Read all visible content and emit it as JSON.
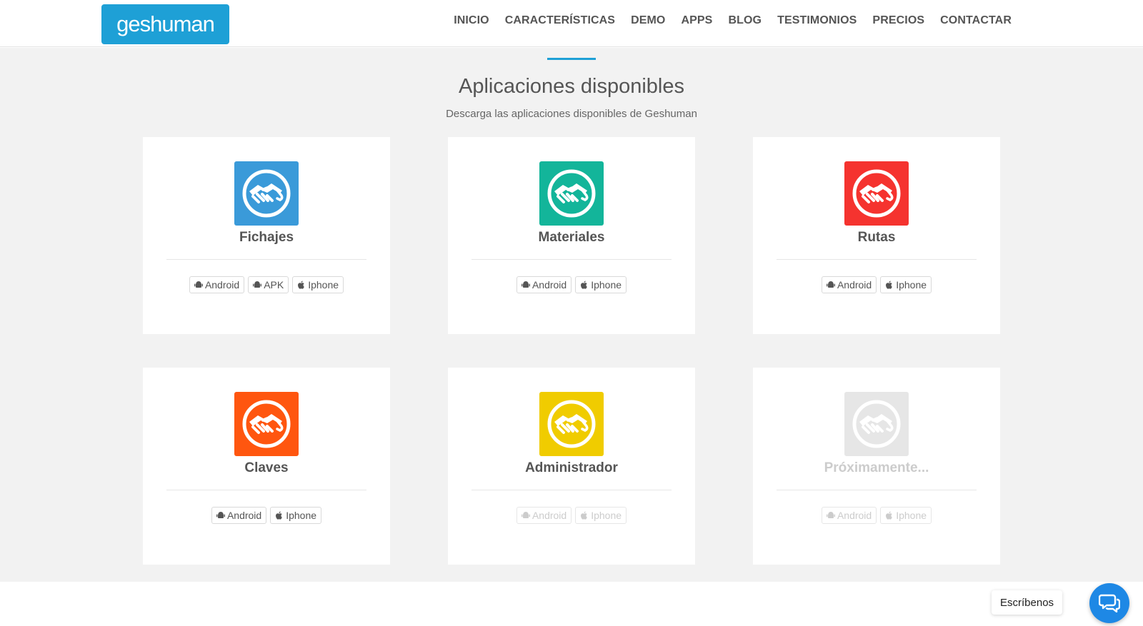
{
  "header": {
    "logo_text": "geshuman",
    "nav": [
      "INICIO",
      "CARACTERÍSTICAS",
      "DEMO",
      "APPS",
      "BLOG",
      "TESTIMONIOS",
      "PRECIOS",
      "CONTACTAR"
    ]
  },
  "section": {
    "title": "Aplicaciones disponibles",
    "subtitle": "Descarga las aplicaciones disponibles de Geshuman"
  },
  "apps": [
    {
      "name": "Fichajes",
      "color": "#3a9ad9",
      "buttons": [
        "Android",
        "APK",
        "Iphone"
      ],
      "disabled": false
    },
    {
      "name": "Materiales",
      "color": "#13b59a",
      "buttons": [
        "Android",
        "Iphone"
      ],
      "disabled": false
    },
    {
      "name": "Rutas",
      "color": "#f5332f",
      "buttons": [
        "Android",
        "Iphone"
      ],
      "disabled": false
    },
    {
      "name": "Claves",
      "color": "#ff560f",
      "buttons": [
        "Android",
        "Iphone"
      ],
      "disabled": false
    },
    {
      "name": "Administrador",
      "color": "#f0cc00",
      "buttons": [
        "Android",
        "Iphone"
      ],
      "disabled": true
    },
    {
      "name": "Próximamente...",
      "color": "#e6e6e6",
      "buttons": [
        "Android",
        "Iphone"
      ],
      "disabled": true
    }
  ],
  "chat": {
    "label": "Escríbenos"
  }
}
